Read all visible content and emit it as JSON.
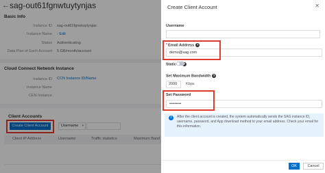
{
  "page": {
    "title": "sag-out61fgnwtuytynjas",
    "back_icon": "arrow-left-icon"
  },
  "basic_info": {
    "heading": "Basic Info",
    "rows": [
      {
        "label": "Instance ID",
        "value": "sag-out61fgnwtuytynjas"
      },
      {
        "label": "Instance Name",
        "value": "- Edit"
      },
      {
        "label": "Status",
        "value": "Authenticating"
      },
      {
        "label": "Data Plan of Each Account",
        "value": "5 GB/month/account"
      }
    ]
  },
  "ccn": {
    "heading": "Cloud Connect Network Instance",
    "rows": [
      {
        "label": "Instance ID",
        "value": "CCN Instance ID/Name"
      },
      {
        "label": "Instance Name",
        "value": ""
      },
      {
        "label": "CEN Instance",
        "value": ""
      }
    ]
  },
  "client_accounts": {
    "heading": "Client Accounts",
    "create_button": "Create Client Account",
    "filter_select": "Username",
    "columns": [
      "Client IP Address",
      "Username",
      "Traffic statistics",
      "Maximum Bandwi"
    ]
  },
  "panel": {
    "title": "Create Client Account",
    "close_icon": "close-icon",
    "username": {
      "label": "Username",
      "value": ""
    },
    "email": {
      "label": "Email Address",
      "required": "*",
      "value": "demo@sag.com"
    },
    "static_ip": {
      "label": "Static IP",
      "on": false
    },
    "bandwidth": {
      "label": "Set Maximum Bandwidth",
      "value": "2000",
      "unit": "Kbps"
    },
    "password": {
      "label": "Set Password",
      "value": "•••••••••"
    },
    "help_icon": "?",
    "info_icon": "i",
    "note": "After the client account is created, the system automatically sends the SAG instance ID, username, password, and App download method to your email address. Check your email for this information.",
    "ok": "OK",
    "cancel": "Cancel"
  },
  "colors": {
    "primary": "#0070cc",
    "highlight": "#e03a2f",
    "note_bg": "#e7f2ff"
  }
}
